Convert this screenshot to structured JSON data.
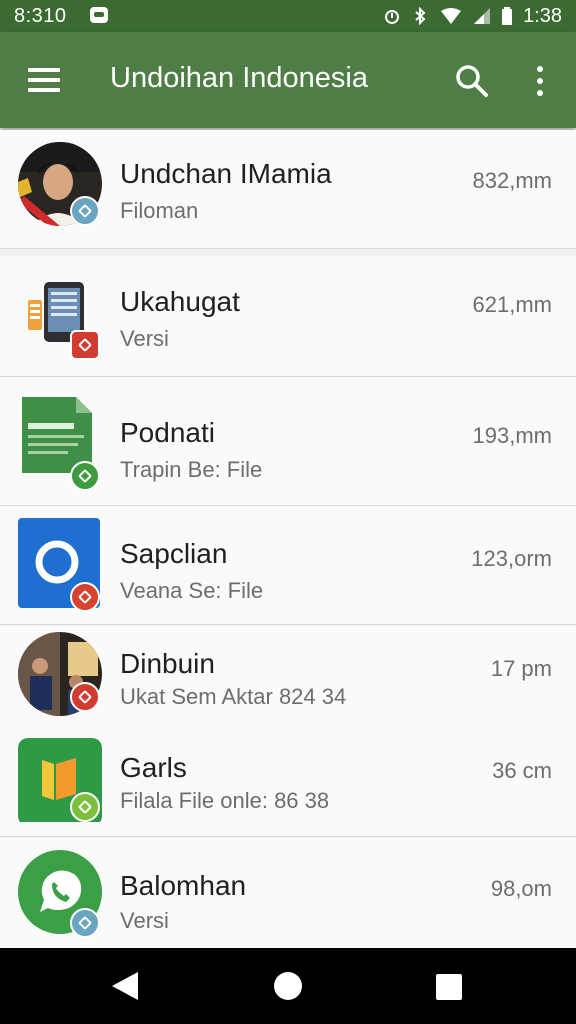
{
  "status_bar": {
    "left_time": "8:310",
    "right_time": "1:38",
    "icons": [
      "notification-icon",
      "alarm-icon",
      "bluetooth-icon",
      "wifi-icon",
      "signal-icon",
      "battery-icon"
    ]
  },
  "app_bar": {
    "title": "Undoihan Indonesia",
    "icons": [
      "menu-icon",
      "search-icon",
      "more-vert-icon"
    ]
  },
  "items": [
    {
      "title": "Undchan IMamia",
      "subtitle": "Filoman",
      "time": "832,mm",
      "icon": "avatar-person-icon",
      "badge_color": "#6aa5c2"
    },
    {
      "title": "Ukahugat",
      "subtitle": "Versi",
      "time": "621,mm",
      "icon": "document-phone-icon",
      "badge_color": "#d23b2f"
    },
    {
      "title": "Podnati",
      "subtitle": "Trapin Be: File",
      "time": "193,mm",
      "icon": "green-document-icon",
      "badge_color": "#3f9a3f"
    },
    {
      "title": "Sapclian",
      "subtitle": "Veana Se: File",
      "time": "123,orm",
      "icon": "blue-circle-app-icon",
      "badge_color": "#d6442f"
    },
    {
      "title": "Dinbuin",
      "subtitle": "Ukat Sem Aktar 824 34",
      "time": "17 pm",
      "icon": "avatar-group-icon",
      "badge_color": "#d23b2f"
    },
    {
      "title": "Garls",
      "subtitle": "Filala File onle: 86 38",
      "time": "36 cm",
      "icon": "green-square-app-icon",
      "badge_color": "#7cbf3c"
    },
    {
      "title": "Balomhan",
      "subtitle": "Versi",
      "time": "98,om",
      "icon": "whatsapp-icon",
      "badge_color": "#6aa5c2"
    }
  ],
  "nav_bar": {
    "icons": [
      "back-icon",
      "home-icon",
      "recents-icon"
    ]
  }
}
